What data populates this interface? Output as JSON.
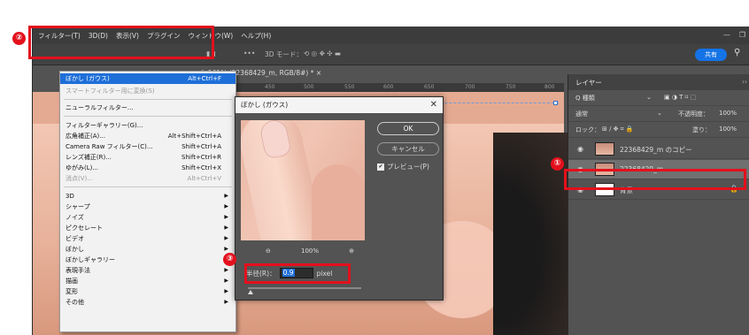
{
  "menubar": {
    "items": [
      "フィルター(T)",
      "3D(D)",
      "表示(V)",
      "プラグイン",
      "ウィンドウ(W)",
      "ヘルプ(H)"
    ]
  },
  "optbar": {
    "mode_label": "3D モード：",
    "share_label": "共有"
  },
  "doc_tab": "@ 161% (22368429_m, RGB/8#) * ×",
  "ruler": [
    "400",
    "450",
    "500",
    "550",
    "600",
    "650",
    "700",
    "750",
    "800"
  ],
  "filter_menu": {
    "items": [
      {
        "label": "ぼかし (ガウス)",
        "shortcut": "Alt+Ctrl+F",
        "state": "selected",
        "submenu": false
      },
      {
        "label": "スマートフィルター用に変換(S)",
        "shortcut": "",
        "state": "disabled",
        "submenu": false
      },
      {
        "label": "ニューラルフィルター...",
        "shortcut": "",
        "state": "normal",
        "submenu": false
      },
      {
        "label": "フィルターギャラリー(G)...",
        "shortcut": "",
        "state": "normal",
        "submenu": false
      },
      {
        "label": "広角補正(A)...",
        "shortcut": "Alt+Shift+Ctrl+A",
        "state": "normal",
        "submenu": false
      },
      {
        "label": "Camera Raw フィルター(C)...",
        "shortcut": "Shift+Ctrl+A",
        "state": "normal",
        "submenu": false
      },
      {
        "label": "レンズ補正(R)...",
        "shortcut": "Shift+Ctrl+R",
        "state": "normal",
        "submenu": false
      },
      {
        "label": "ゆがみ(L)...",
        "shortcut": "Shift+Ctrl+X",
        "state": "normal",
        "submenu": false
      },
      {
        "label": "消点(V)...",
        "shortcut": "Alt+Ctrl+V",
        "state": "disabled",
        "submenu": false
      },
      {
        "label": "3D",
        "shortcut": "",
        "state": "normal",
        "submenu": true
      },
      {
        "label": "シャープ",
        "shortcut": "",
        "state": "normal",
        "submenu": true
      },
      {
        "label": "ノイズ",
        "shortcut": "",
        "state": "normal",
        "submenu": true
      },
      {
        "label": "ピクセレート",
        "shortcut": "",
        "state": "normal",
        "submenu": true
      },
      {
        "label": "ビデオ",
        "shortcut": "",
        "state": "normal",
        "submenu": true
      },
      {
        "label": "ぼかし",
        "shortcut": "",
        "state": "normal",
        "submenu": true
      },
      {
        "label": "ぼかしギャラリー",
        "shortcut": "",
        "state": "normal",
        "submenu": true
      },
      {
        "label": "表現手法",
        "shortcut": "",
        "state": "normal",
        "submenu": true
      },
      {
        "label": "描画",
        "shortcut": "",
        "state": "normal",
        "submenu": true
      },
      {
        "label": "変形",
        "shortcut": "",
        "state": "normal",
        "submenu": true
      },
      {
        "label": "その他",
        "shortcut": "",
        "state": "normal",
        "submenu": true
      }
    ]
  },
  "blur_dialog": {
    "title": "ぼかし (ガウス)",
    "ok_label": "OK",
    "cancel_label": "キャンセル",
    "preview_label": "プレビュー(P)",
    "preview_checked": true,
    "zoom_out_icon": "zoom-out",
    "zoom_level": "100%",
    "zoom_in_icon": "zoom-in",
    "radius_label": "半径(R)：",
    "radius_value": "0.9",
    "radius_unit": "pixel",
    "radius_slider_position": 0.0
  },
  "layers_panel": {
    "tab_label": "レイヤー",
    "collapse_label": "››",
    "kind_label": "Q 種類",
    "blend_mode": "通常",
    "opacity_label": "不透明度：",
    "opacity_value": "100%",
    "lock_label": "ロック：",
    "fill_label": "塗り：",
    "fill_value": "100%",
    "layers": [
      {
        "name": "22368429_m のコピー",
        "selected": false,
        "locked": false
      },
      {
        "name": "22368429_m",
        "selected": true,
        "locked": false
      },
      {
        "name": "背景",
        "selected": false,
        "locked": true
      }
    ]
  },
  "annotations": {
    "marker1": "①",
    "marker2": "②",
    "marker3": "③",
    "color": "#e3101c"
  }
}
